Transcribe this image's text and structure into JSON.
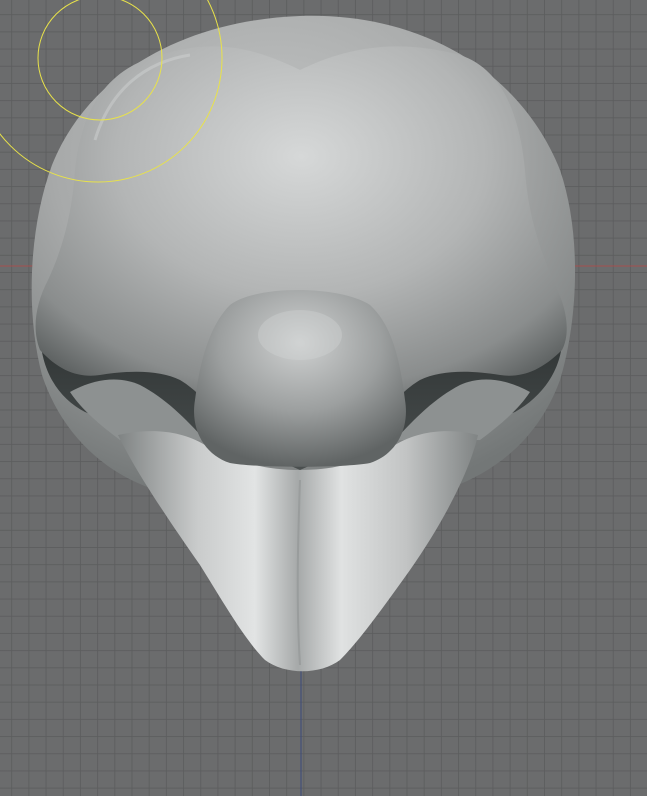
{
  "viewport": {
    "background": "#6b6c6d",
    "grid_line_color": "#5c5d5e",
    "x_axis_color": "#b34a4a",
    "y_axis_color": "#3b4a7a"
  },
  "model": {
    "name": "sculpted-head-mesh",
    "base_color": "#a9abaa",
    "highlight_color": "#d9dbdb",
    "shadow_color": "#3d4142"
  },
  "brush_cursor": {
    "color": "#e8e24a"
  }
}
